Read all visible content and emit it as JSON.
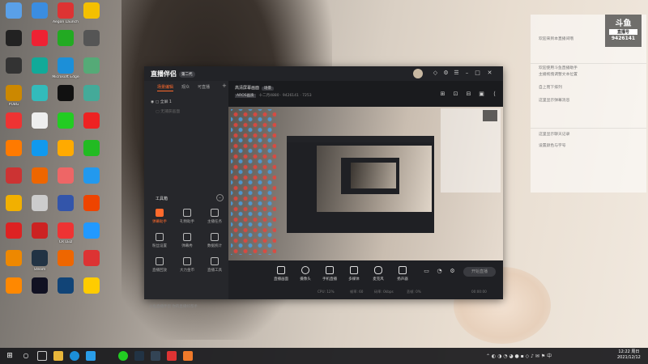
{
  "desktop": {
    "icons": [
      {
        "label": "",
        "color": "#5aa0e8"
      },
      {
        "label": "",
        "color": "#3b8de0"
      },
      {
        "label": "Aegon Launch",
        "color": "#d33"
      },
      {
        "label": "",
        "color": "#f4c000"
      },
      {
        "label": "",
        "color": "#222"
      },
      {
        "label": "",
        "color": "#e23"
      },
      {
        "label": "",
        "color": "#2a2"
      },
      {
        "label": "",
        "color": "#555"
      },
      {
        "label": "",
        "color": "#333"
      },
      {
        "label": "",
        "color": "#1a9"
      },
      {
        "label": "Microsoft Edge",
        "color": "#1c8fd8"
      },
      {
        "label": "",
        "color": "#5a7"
      },
      {
        "label": "PUBG",
        "color": "#c80"
      },
      {
        "label": "",
        "color": "#3bb"
      },
      {
        "label": "",
        "color": "#111"
      },
      {
        "label": "",
        "color": "#4a9"
      },
      {
        "label": "",
        "color": "#e33"
      },
      {
        "label": "",
        "color": "#eee"
      },
      {
        "label": "",
        "color": "#2c2"
      },
      {
        "label": "",
        "color": "#e22"
      },
      {
        "label": "",
        "color": "#ff7a00"
      },
      {
        "label": "",
        "color": "#19e"
      },
      {
        "label": "",
        "color": "#fa0"
      },
      {
        "label": "",
        "color": "#2b2"
      },
      {
        "label": "",
        "color": "#c33"
      },
      {
        "label": "",
        "color": "#e60"
      },
      {
        "label": "",
        "color": "#e66"
      },
      {
        "label": "",
        "color": "#29e"
      },
      {
        "label": "",
        "color": "#f2b000"
      },
      {
        "label": "",
        "color": "#ccc"
      },
      {
        "label": "",
        "color": "#35a"
      },
      {
        "label": "",
        "color": "#e40"
      },
      {
        "label": "",
        "color": "#d22"
      },
      {
        "label": "",
        "color": "#c22"
      },
      {
        "label": "CR LED",
        "color": "#e33"
      },
      {
        "label": "",
        "color": "#29f"
      },
      {
        "label": "",
        "color": "#e80"
      },
      {
        "label": "Steam",
        "color": "#234"
      },
      {
        "label": "",
        "color": "#e60"
      },
      {
        "label": "",
        "color": "#d33"
      },
      {
        "label": "",
        "color": "#f80"
      },
      {
        "label": "",
        "color": "#112"
      },
      {
        "label": "",
        "color": "#147"
      },
      {
        "label": "",
        "color": "#fc0"
      }
    ]
  },
  "chat": {
    "logo": "斗鱼",
    "logo_sub": "直播号",
    "logo_num": "9426141",
    "messages": [
      "欢迎来到本直播间哦",
      "欢迎使用斗鱼直播助手",
      "主播拖拽调整文本位置",
      "自上而下排列",
      "这里显示弹幕消息",
      "这里显示聊天记录",
      "设置颜色与字号"
    ]
  },
  "app": {
    "title": "直播伴侣",
    "title_badge": "第二代",
    "tabs": [
      "场景编辑",
      "观众",
      "可直播"
    ],
    "add_tab": "+",
    "scene_rows": [
      "全屏 1",
      "无捕获画面"
    ],
    "tools_title": "工具箱",
    "tools": [
      {
        "label": "弹幕助手",
        "hot": true
      },
      {
        "label": "礼物助手",
        "hot": false
      },
      {
        "label": "主播任务",
        "hot": false
      },
      {
        "label": "粉丝设置",
        "hot": false
      },
      {
        "label": "弹幕秀",
        "hot": false
      },
      {
        "label": "数据统计",
        "hot": false
      },
      {
        "label": "直播回放",
        "hot": false
      },
      {
        "label": "大力金币",
        "hot": false
      },
      {
        "label": "直播工具",
        "hot": false
      }
    ],
    "left_status": "斗鱼直播伴侣 你的直播好帮手",
    "scene_name": "高清屏幕画面",
    "scene_badge": "场景",
    "rec_label": "AROS画质",
    "info_text": "十二月4880 · 9426141 · 7253",
    "bottom_buttons": [
      "直播画面",
      "摄像头",
      "手机直播",
      "多媒体",
      "麦克风",
      "扬声器"
    ],
    "live_button": "开始直播",
    "bottom_status": [
      "CPU: 12%",
      "帧率: 60",
      "码率: 0kbps",
      "丢帧: 0%",
      "00:00:00"
    ]
  },
  "taskbar": {
    "time": "12:22 周日",
    "date": "2021/12/12",
    "icons": [
      "start",
      "search",
      "task-view",
      "file-explorer",
      "edge",
      "browser",
      "steam",
      "game",
      "app",
      "live-app"
    ]
  }
}
